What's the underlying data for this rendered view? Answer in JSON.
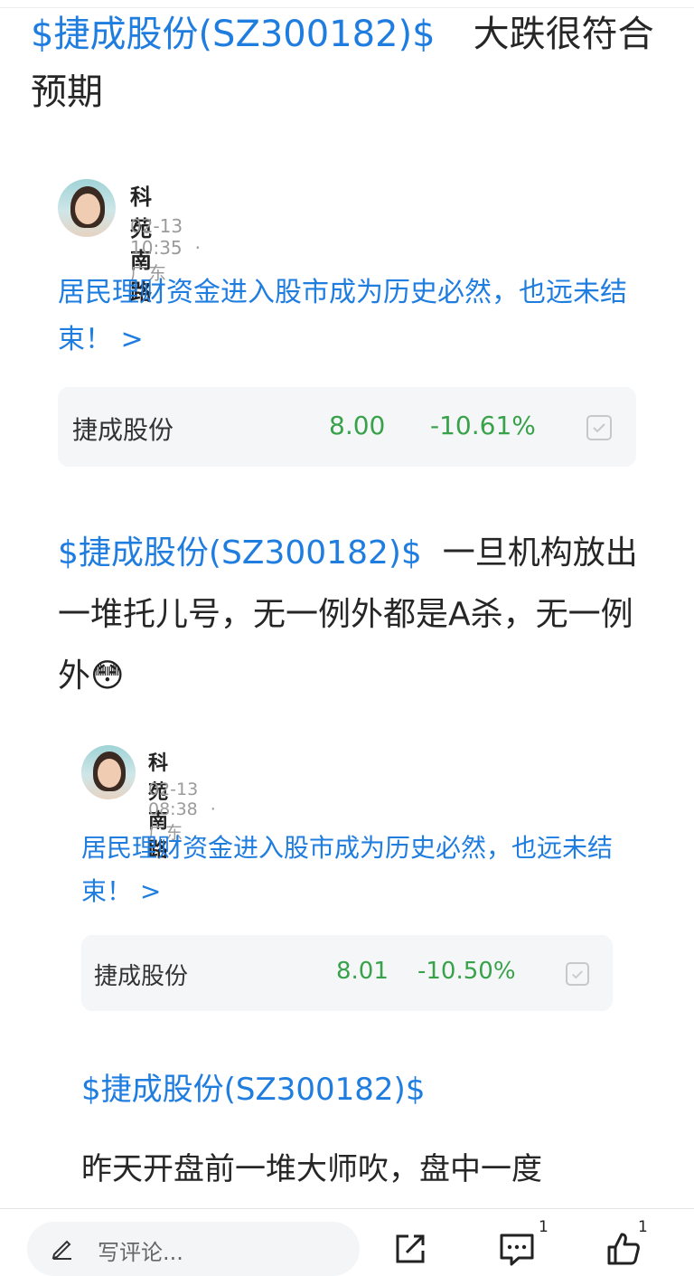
{
  "main_post": {
    "stock_tag": "$捷成股份(SZ300182)$",
    "text": "大跌很符合预期"
  },
  "quotes": [
    {
      "author": "科苑南路",
      "time": "02-13 10:35",
      "location": "广东",
      "headline": "居民理财资金进入股市成为历史必然，也远未结束！ >",
      "stock": {
        "name": "捷成股份",
        "price": "8.00",
        "change": "-10.61%"
      }
    },
    {
      "stock_tag": "$捷成股份(SZ300182)$",
      "text": "一旦机构放出一堆托儿号，无一例外都是A杀，无一例外",
      "emoji": "😳"
    },
    {
      "author": "科苑南路",
      "time": "02-13 08:38",
      "location": "广东",
      "headline": "居民理财资金进入股市成为历史必然，也远未结束！ >",
      "stock": {
        "name": "捷成股份",
        "price": "8.01",
        "change": "-10.50%"
      }
    },
    {
      "stock_tag": "$捷成股份(SZ300182)$",
      "text": "昨天开盘前一堆大师吹，盘中一度"
    }
  ],
  "bottom_bar": {
    "comment_placeholder": "写评论...",
    "comment_count": "1",
    "like_count": "1"
  },
  "colors": {
    "link": "#1f7de0",
    "down": "#38a24a"
  },
  "icons": [
    "pencil-icon",
    "share-icon",
    "comment-icon",
    "thumbs-up-icon",
    "checkbox-icon"
  ]
}
